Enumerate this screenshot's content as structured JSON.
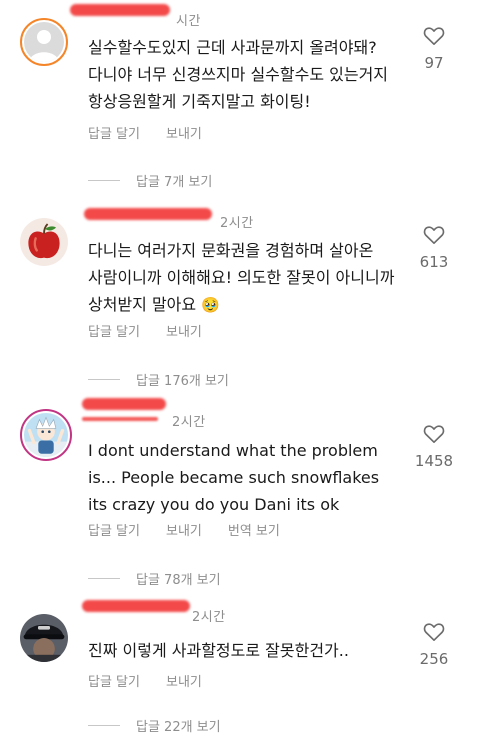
{
  "comments": [
    {
      "time": "시간",
      "text": "실수할수도있지 근데 사과문까지 올려야돼?\n다니야 너무 신경쓰지마 실수할수도 있는거지\n항상응원할게 기죽지말고 화이팅!",
      "reply_label": "답글 달기",
      "send_label": "보내기",
      "likes": "97",
      "view_replies": "답글 7개 보기",
      "avatar": "default-avatar-icon"
    },
    {
      "time": "2시간",
      "text": "다니는 여러가지 문화권을 경험하며 살아온\n사람이니까 이해해요! 의도한 잘못이 아니니까\n상처받지 말아요",
      "emoji": "🥹",
      "reply_label": "답글 달기",
      "send_label": "보내기",
      "likes": "613",
      "view_replies": "답글 176개 보기",
      "avatar": "apple-avatar"
    },
    {
      "time": "2시간",
      "text": "I dont understand what the problem\nis... People became such snowflakes\nits crazy you do you Dani its ok",
      "reply_label": "답글 달기",
      "send_label": "보내기",
      "translate_label": "번역 보기",
      "likes": "1458",
      "view_replies": "답글 78개 보기",
      "avatar": "anime-avatar"
    },
    {
      "time": "2시간",
      "text": "진짜 이렇게 사과할정도로 잘못한건가..",
      "reply_label": "답글 달기",
      "send_label": "보내기",
      "likes": "256",
      "view_replies": "답글 22개 보기",
      "avatar": "cap-avatar"
    }
  ],
  "colors": {
    "redaction": "#f23a3a",
    "muted": "#8e8e8e",
    "story_ring": "#c13584"
  }
}
